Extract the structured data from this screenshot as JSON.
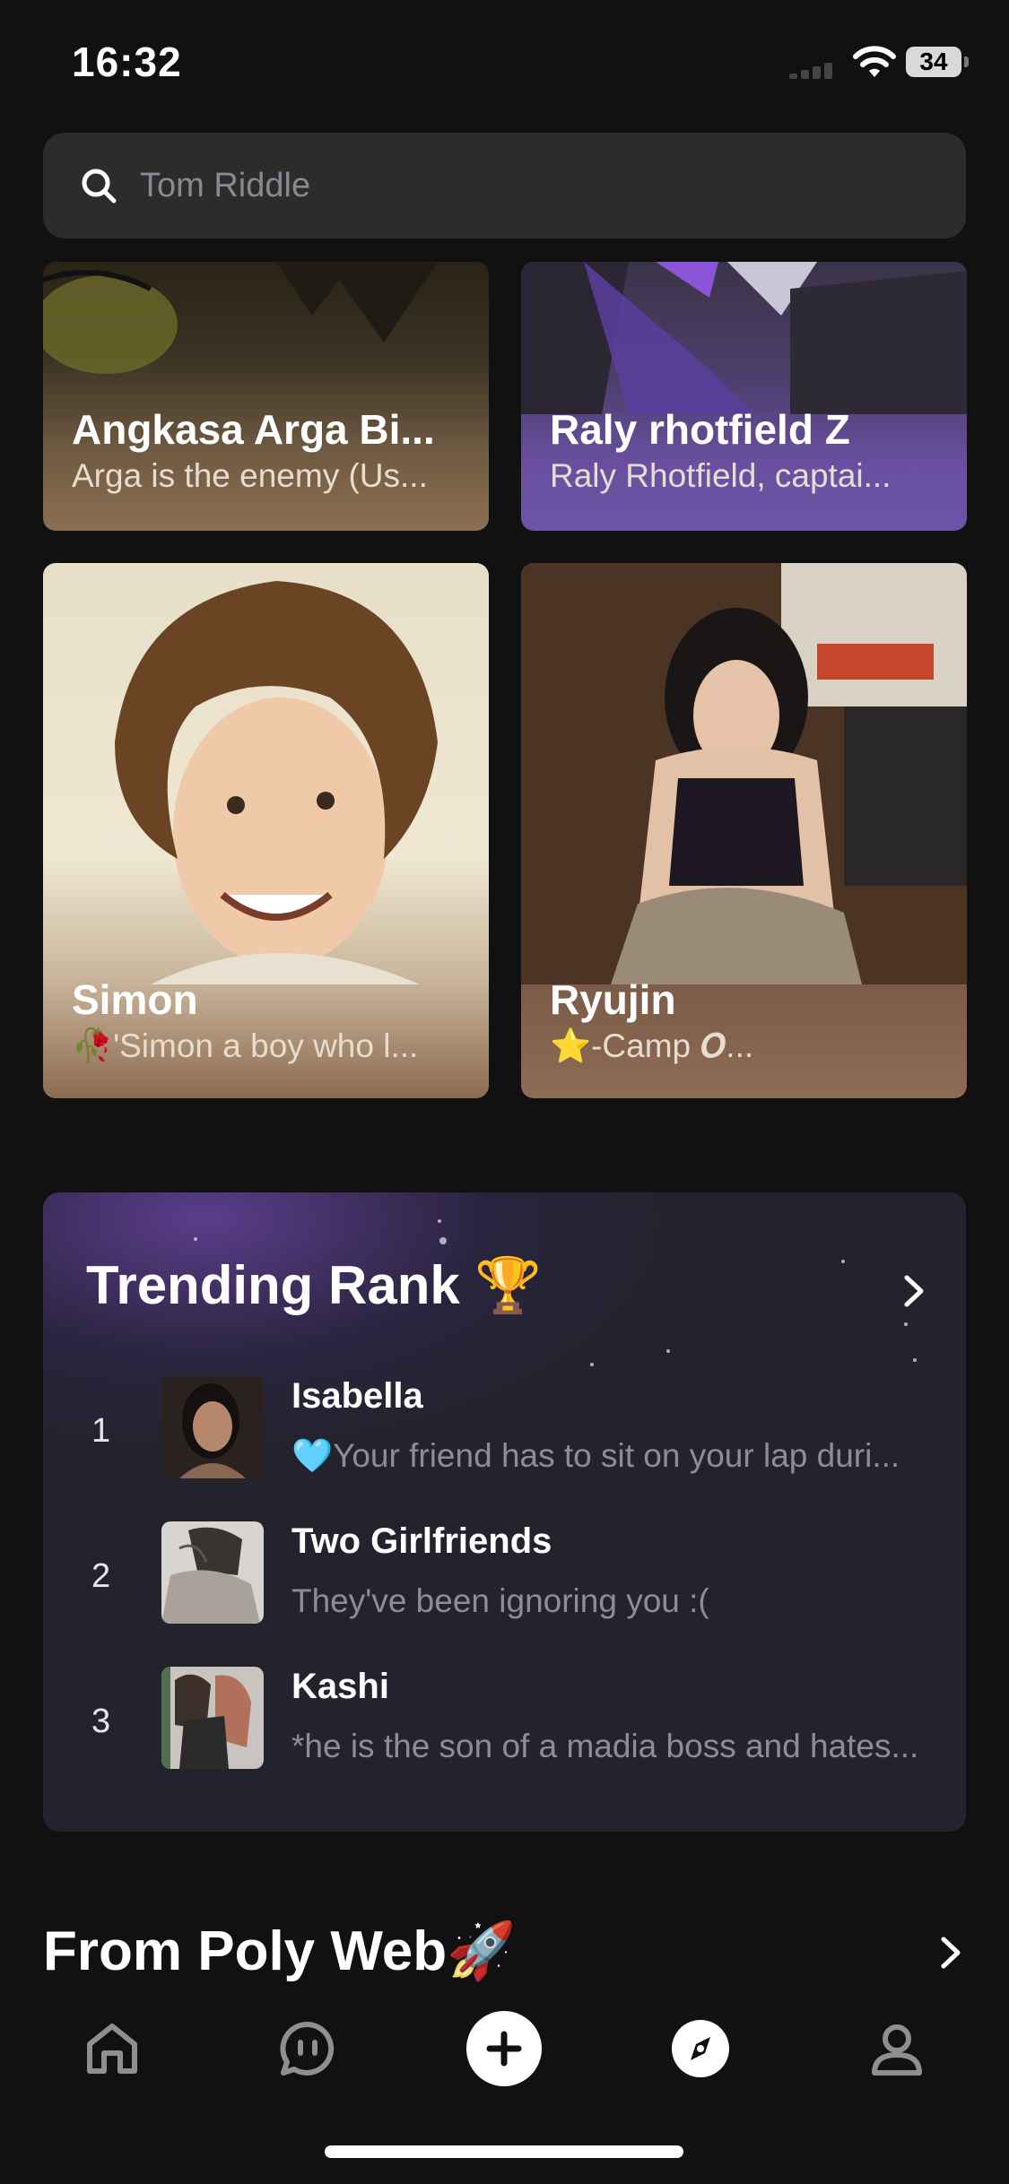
{
  "status": {
    "time": "16:32",
    "battery": "34"
  },
  "search": {
    "placeholder": "Tom Riddle"
  },
  "cards": [
    {
      "name": "Angkasa Arga Bi...",
      "desc": "Arga is the enemy (Us..."
    },
    {
      "name": "Raly rhotfield Z",
      "desc": "Raly Rhotfield, captai..."
    },
    {
      "name": "Simon",
      "desc": "🥀'Simon a boy who l..."
    },
    {
      "name": "Ryujin",
      "desc": "⭐-Camp 𝑶..."
    }
  ],
  "trending": {
    "title": "Trending Rank 🏆",
    "items": [
      {
        "rank": "1",
        "name": "Isabella",
        "desc": "🩵Your friend has to sit on your lap duri..."
      },
      {
        "rank": "2",
        "name": "Two Girlfriends",
        "desc": "They've been ignoring you :("
      },
      {
        "rank": "3",
        "name": "Kashi",
        "desc": "*he is the son of a madia boss and hates..."
      }
    ]
  },
  "section": {
    "title": "From Poly Web🚀"
  },
  "tabs": [
    "home-icon",
    "chat-icon",
    "create-icon",
    "explore-icon",
    "profile-icon"
  ]
}
